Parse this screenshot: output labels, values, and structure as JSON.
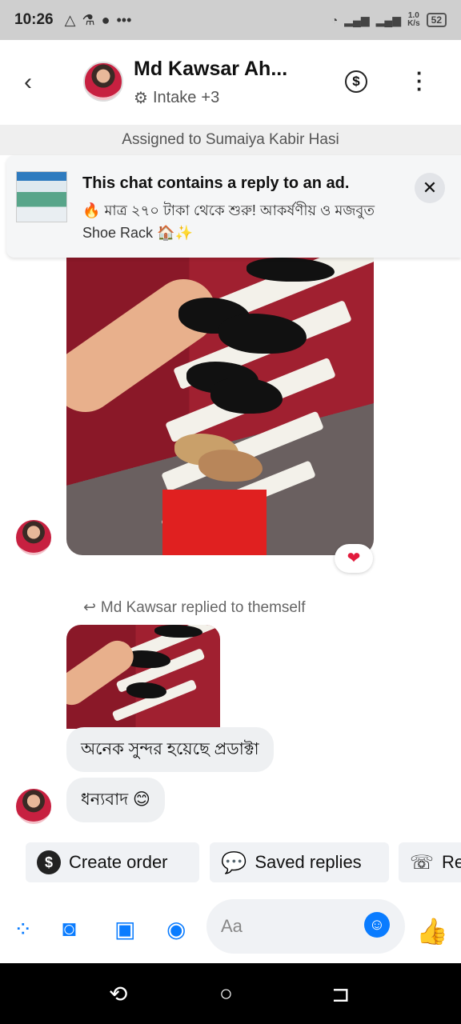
{
  "status_bar": {
    "time": "10:26",
    "speed_top": "1.0",
    "speed_bottom": "K/s",
    "battery": "52"
  },
  "header": {
    "name": "Md Kawsar Ah...",
    "label": "Intake",
    "label_extra": "+3"
  },
  "assigned": "Assigned to Sumaiya Kabir Hasi",
  "ad": {
    "title": "This chat contains a reply to an ad.",
    "text_prefix": "🔥",
    "text": "মাত্র ২৭০ টাকা থেকে শুরু!  আকর্ষণীয় ও মজবুত  Shoe Rack",
    "text_suffix": "🏠✨"
  },
  "messages": {
    "reaction": "❤",
    "replied_label": "Md Kawsar replied to themself",
    "bubble1": "অনেক সুন্দর হয়েছে প্রডাক্টা",
    "bubble2": "ধন্যবাদ 😊"
  },
  "quick_replies": {
    "create_order": "Create order",
    "saved_replies": "Saved replies",
    "third": "Re"
  },
  "composer": {
    "placeholder": "Aa"
  }
}
